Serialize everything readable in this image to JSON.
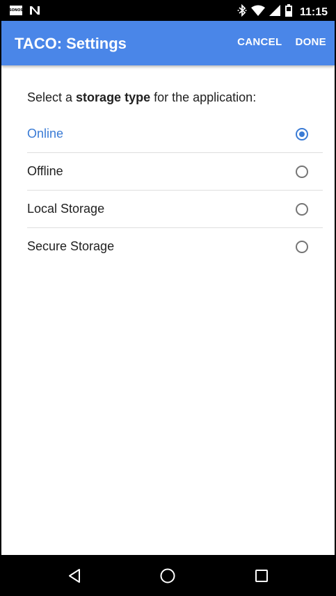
{
  "status_bar": {
    "time": "11:15",
    "left_icons": [
      "sonos-icon",
      "n-notification-icon"
    ],
    "sonos_text": "SONOS",
    "right_icons": [
      "bluetooth-icon",
      "wifi-icon",
      "signal-icon",
      "battery-icon"
    ]
  },
  "toolbar": {
    "title": "TACO: Settings",
    "cancel_label": "CANCEL",
    "done_label": "DONE",
    "accent_color": "#4a86e8"
  },
  "content": {
    "prompt_prefix": "Select a ",
    "prompt_bold": "storage type",
    "prompt_suffix": " for the application:",
    "options": [
      {
        "label": "Online",
        "selected": true
      },
      {
        "label": "Offline",
        "selected": false
      },
      {
        "label": "Local Storage",
        "selected": false
      },
      {
        "label": "Secure Storage",
        "selected": false
      }
    ],
    "selected_color": "#3a7bd5"
  },
  "nav_bar": {
    "buttons": [
      "back-icon",
      "home-icon",
      "recents-icon"
    ]
  }
}
